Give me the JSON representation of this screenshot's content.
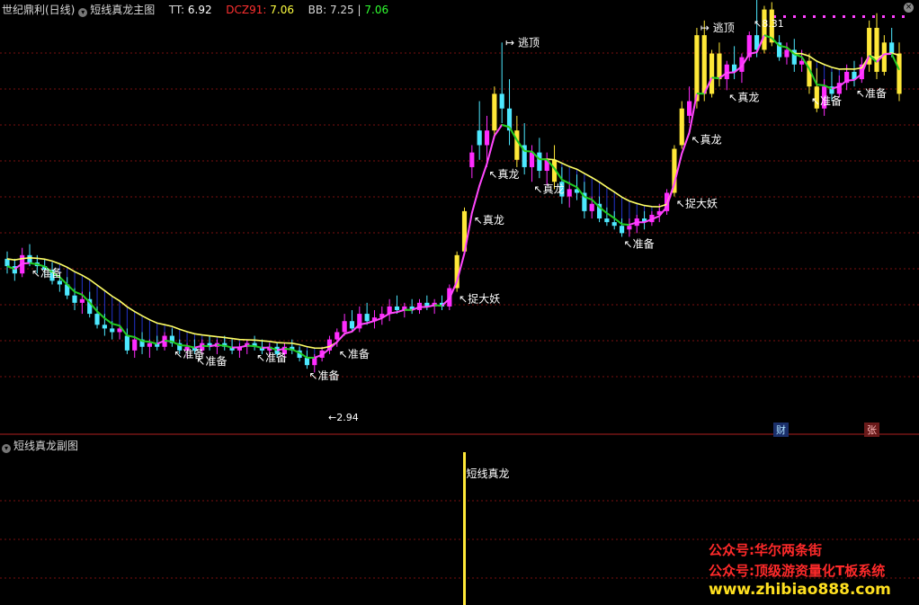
{
  "header": {
    "app_name": "世纪鼎利(日线)",
    "indicator_name": "短线真龙主图",
    "tt_label": "TT:",
    "tt_value": "6.92",
    "dcz_label": "DCZ91:",
    "dcz_value": "7.06",
    "bb_label": "BB:",
    "bb_value": "7.25",
    "bb_value2": "7.06"
  },
  "sub_header": {
    "indicator_name": "短线真龙副图"
  },
  "tags": {
    "cai": "财",
    "zhang": "张"
  },
  "watermark": {
    "line1": "公众号:华尔两条街",
    "line2": "公众号:顶级游资量化T板系统",
    "line3": "www.zhibiao888.com"
  },
  "colors": {
    "up_candle": "#ff2cff",
    "down_candle": "#4de8ff",
    "yellow_candle": "#ffe838",
    "red_candle": "#ff2020",
    "upper_band": "#ffff66",
    "lower_band_rise": "#ff44ff",
    "lower_band_fall": "#22cc22",
    "fill": "#2233cc",
    "grid": "#7a1010"
  },
  "chart_data": {
    "type": "candlestick",
    "price_labels": {
      "low": "2.94",
      "high": "8.31"
    },
    "annotations": [
      {
        "text": "准备",
        "index": 3
      },
      {
        "text": "准备",
        "index": 22
      },
      {
        "text": "准备",
        "index": 25
      },
      {
        "text": "准备",
        "index": 33
      },
      {
        "text": "准备",
        "index": 40
      },
      {
        "text": "准备",
        "index": 44
      },
      {
        "text": "捉大妖",
        "index": 60
      },
      {
        "text": "真龙",
        "index": 62
      },
      {
        "text": "真龙",
        "index": 64
      },
      {
        "text": "逃顶",
        "index": 66
      },
      {
        "text": "真龙",
        "index": 70
      },
      {
        "text": "准备",
        "index": 82
      },
      {
        "text": "捉大妖",
        "index": 89
      },
      {
        "text": "真龙",
        "index": 91
      },
      {
        "text": "逃顶",
        "index": 92
      },
      {
        "text": "真龙",
        "index": 96
      },
      {
        "text": "准备",
        "index": 107
      },
      {
        "text": "准备",
        "index": 113
      }
    ],
    "sub_annotation": "短线真龙",
    "sub_signal_index": 61,
    "candles": [
      {
        "o": 5.05,
        "h": 5.15,
        "l": 4.85,
        "c": 4.95
      },
      {
        "o": 4.95,
        "h": 5.05,
        "l": 4.75,
        "c": 4.85
      },
      {
        "o": 4.85,
        "h": 5.2,
        "l": 4.8,
        "c": 5.1
      },
      {
        "o": 5.1,
        "h": 5.25,
        "l": 4.95,
        "c": 5.0
      },
      {
        "o": 5.0,
        "h": 5.1,
        "l": 4.85,
        "c": 4.95
      },
      {
        "o": 4.95,
        "h": 5.05,
        "l": 4.8,
        "c": 4.9
      },
      {
        "o": 4.9,
        "h": 5.0,
        "l": 4.7,
        "c": 4.75
      },
      {
        "o": 4.75,
        "h": 4.85,
        "l": 4.6,
        "c": 4.7
      },
      {
        "o": 4.7,
        "h": 4.8,
        "l": 4.5,
        "c": 4.55
      },
      {
        "o": 4.55,
        "h": 4.65,
        "l": 4.35,
        "c": 4.45
      },
      {
        "o": 4.45,
        "h": 4.6,
        "l": 4.3,
        "c": 4.5
      },
      {
        "o": 4.5,
        "h": 4.6,
        "l": 4.25,
        "c": 4.3
      },
      {
        "o": 4.3,
        "h": 4.4,
        "l": 4.1,
        "c": 4.15
      },
      {
        "o": 4.15,
        "h": 4.3,
        "l": 4.0,
        "c": 4.1
      },
      {
        "o": 4.1,
        "h": 4.2,
        "l": 3.95,
        "c": 4.05
      },
      {
        "o": 4.05,
        "h": 4.15,
        "l": 3.95,
        "c": 4.1
      },
      {
        "o": 4.0,
        "h": 4.1,
        "l": 3.75,
        "c": 3.8
      },
      {
        "o": 3.8,
        "h": 4.0,
        "l": 3.7,
        "c": 3.95
      },
      {
        "o": 3.95,
        "h": 4.05,
        "l": 3.75,
        "c": 3.85
      },
      {
        "o": 3.85,
        "h": 3.95,
        "l": 3.7,
        "c": 3.9
      },
      {
        "o": 3.9,
        "h": 4.0,
        "l": 3.8,
        "c": 3.85
      },
      {
        "o": 3.85,
        "h": 4.05,
        "l": 3.8,
        "c": 4.0
      },
      {
        "o": 4.0,
        "h": 4.1,
        "l": 3.85,
        "c": 3.9
      },
      {
        "o": 3.9,
        "h": 3.95,
        "l": 3.75,
        "c": 3.8
      },
      {
        "o": 3.8,
        "h": 3.9,
        "l": 3.7,
        "c": 3.85
      },
      {
        "o": 3.85,
        "h": 3.95,
        "l": 3.75,
        "c": 3.8
      },
      {
        "o": 3.8,
        "h": 3.95,
        "l": 3.75,
        "c": 3.9
      },
      {
        "o": 3.9,
        "h": 4.0,
        "l": 3.8,
        "c": 3.85
      },
      {
        "o": 3.85,
        "h": 3.95,
        "l": 3.75,
        "c": 3.9
      },
      {
        "o": 3.9,
        "h": 4.0,
        "l": 3.8,
        "c": 3.85
      },
      {
        "o": 3.85,
        "h": 3.95,
        "l": 3.75,
        "c": 3.8
      },
      {
        "o": 3.8,
        "h": 3.9,
        "l": 3.7,
        "c": 3.85
      },
      {
        "o": 3.85,
        "h": 3.95,
        "l": 3.75,
        "c": 3.9
      },
      {
        "o": 3.9,
        "h": 4.0,
        "l": 3.8,
        "c": 3.85
      },
      {
        "o": 3.85,
        "h": 3.95,
        "l": 3.75,
        "c": 3.8
      },
      {
        "o": 3.8,
        "h": 3.9,
        "l": 3.7,
        "c": 3.85
      },
      {
        "o": 3.85,
        "h": 3.9,
        "l": 3.7,
        "c": 3.75
      },
      {
        "o": 3.75,
        "h": 3.9,
        "l": 3.7,
        "c": 3.85
      },
      {
        "o": 3.85,
        "h": 3.95,
        "l": 3.75,
        "c": 3.8
      },
      {
        "o": 3.8,
        "h": 3.85,
        "l": 3.65,
        "c": 3.7
      },
      {
        "o": 3.7,
        "h": 3.8,
        "l": 3.55,
        "c": 3.6
      },
      {
        "o": 3.6,
        "h": 3.75,
        "l": 3.5,
        "c": 3.7
      },
      {
        "o": 3.7,
        "h": 3.85,
        "l": 3.65,
        "c": 3.8
      },
      {
        "o": 3.8,
        "h": 4.0,
        "l": 3.75,
        "c": 3.95
      },
      {
        "o": 3.95,
        "h": 4.1,
        "l": 3.85,
        "c": 4.05
      },
      {
        "o": 4.05,
        "h": 4.3,
        "l": 4.0,
        "c": 4.2
      },
      {
        "o": 4.2,
        "h": 4.35,
        "l": 4.05,
        "c": 4.1
      },
      {
        "o": 4.1,
        "h": 4.4,
        "l": 4.05,
        "c": 4.3
      },
      {
        "o": 4.3,
        "h": 4.45,
        "l": 4.15,
        "c": 4.2
      },
      {
        "o": 4.2,
        "h": 4.35,
        "l": 4.1,
        "c": 4.25
      },
      {
        "o": 4.25,
        "h": 4.4,
        "l": 4.15,
        "c": 4.3
      },
      {
        "o": 4.3,
        "h": 4.5,
        "l": 4.2,
        "c": 4.4
      },
      {
        "o": 4.4,
        "h": 4.55,
        "l": 4.3,
        "c": 4.35
      },
      {
        "o": 4.35,
        "h": 4.45,
        "l": 4.25,
        "c": 4.4
      },
      {
        "o": 4.4,
        "h": 4.5,
        "l": 4.3,
        "c": 4.35
      },
      {
        "o": 4.35,
        "h": 4.5,
        "l": 4.3,
        "c": 4.45
      },
      {
        "o": 4.45,
        "h": 4.55,
        "l": 4.35,
        "c": 4.4
      },
      {
        "o": 4.4,
        "h": 4.5,
        "l": 4.3,
        "c": 4.45
      },
      {
        "o": 4.45,
        "h": 4.55,
        "l": 4.35,
        "c": 4.4
      },
      {
        "o": 4.4,
        "h": 4.7,
        "l": 4.35,
        "c": 4.65
      },
      {
        "o": 4.65,
        "h": 5.15,
        "l": 4.6,
        "c": 5.1
      },
      {
        "o": 5.15,
        "h": 5.75,
        "l": 5.1,
        "c": 5.7
      },
      {
        "o": 6.3,
        "h": 6.6,
        "l": 6.15,
        "c": 6.5
      },
      {
        "o": 6.8,
        "h": 7.2,
        "l": 6.4,
        "c": 6.6
      },
      {
        "o": 6.6,
        "h": 7.0,
        "l": 6.3,
        "c": 6.8
      },
      {
        "o": 6.8,
        "h": 7.4,
        "l": 6.7,
        "c": 7.3
      },
      {
        "o": 7.3,
        "h": 8.0,
        "l": 6.9,
        "c": 7.1
      },
      {
        "o": 7.1,
        "h": 7.5,
        "l": 6.6,
        "c": 6.8
      },
      {
        "o": 6.8,
        "h": 7.0,
        "l": 6.3,
        "c": 6.4
      },
      {
        "o": 6.6,
        "h": 6.9,
        "l": 6.2,
        "c": 6.3
      },
      {
        "o": 6.3,
        "h": 6.6,
        "l": 6.1,
        "c": 6.5
      },
      {
        "o": 6.5,
        "h": 6.7,
        "l": 6.15,
        "c": 6.25
      },
      {
        "o": 6.25,
        "h": 6.5,
        "l": 6.05,
        "c": 6.4
      },
      {
        "o": 6.4,
        "h": 6.6,
        "l": 6.0,
        "c": 6.1
      },
      {
        "o": 6.1,
        "h": 6.3,
        "l": 5.8,
        "c": 5.9
      },
      {
        "o": 5.9,
        "h": 6.1,
        "l": 5.75,
        "c": 6.0
      },
      {
        "o": 6.0,
        "h": 6.2,
        "l": 5.85,
        "c": 5.95
      },
      {
        "o": 5.95,
        "h": 6.1,
        "l": 5.6,
        "c": 5.7
      },
      {
        "o": 5.7,
        "h": 5.9,
        "l": 5.6,
        "c": 5.8
      },
      {
        "o": 5.8,
        "h": 5.9,
        "l": 5.55,
        "c": 5.6
      },
      {
        "o": 5.6,
        "h": 5.75,
        "l": 5.5,
        "c": 5.55
      },
      {
        "o": 5.55,
        "h": 5.7,
        "l": 5.45,
        "c": 5.5
      },
      {
        "o": 5.5,
        "h": 5.6,
        "l": 5.35,
        "c": 5.4
      },
      {
        "o": 5.45,
        "h": 5.6,
        "l": 5.35,
        "c": 5.5
      },
      {
        "o": 5.5,
        "h": 5.65,
        "l": 5.4,
        "c": 5.6
      },
      {
        "o": 5.6,
        "h": 5.7,
        "l": 5.45,
        "c": 5.55
      },
      {
        "o": 5.55,
        "h": 5.7,
        "l": 5.5,
        "c": 5.65
      },
      {
        "o": 5.65,
        "h": 5.8,
        "l": 5.55,
        "c": 5.7
      },
      {
        "o": 5.7,
        "h": 6.0,
        "l": 5.65,
        "c": 5.95
      },
      {
        "o": 5.95,
        "h": 6.6,
        "l": 5.9,
        "c": 6.55
      },
      {
        "o": 6.6,
        "h": 7.2,
        "l": 6.55,
        "c": 7.1
      },
      {
        "o": 7.0,
        "h": 7.4,
        "l": 6.9,
        "c": 7.2
      },
      {
        "o": 7.2,
        "h": 8.2,
        "l": 7.1,
        "c": 8.1
      },
      {
        "o": 8.1,
        "h": 8.3,
        "l": 7.2,
        "c": 7.3
      },
      {
        "o": 7.3,
        "h": 7.9,
        "l": 7.25,
        "c": 7.85
      },
      {
        "o": 7.85,
        "h": 8.0,
        "l": 7.4,
        "c": 7.5
      },
      {
        "o": 7.5,
        "h": 7.75,
        "l": 7.35,
        "c": 7.7
      },
      {
        "o": 7.7,
        "h": 7.95,
        "l": 7.5,
        "c": 7.6
      },
      {
        "o": 7.6,
        "h": 7.85,
        "l": 7.45,
        "c": 7.8
      },
      {
        "o": 7.8,
        "h": 8.15,
        "l": 7.75,
        "c": 8.1
      },
      {
        "o": 8.1,
        "h": 8.6,
        "l": 7.8,
        "c": 7.9
      },
      {
        "o": 7.9,
        "h": 8.5,
        "l": 7.85,
        "c": 8.45
      },
      {
        "o": 8.45,
        "h": 8.55,
        "l": 7.95,
        "c": 8.0
      },
      {
        "o": 8.0,
        "h": 8.1,
        "l": 7.75,
        "c": 7.8
      },
      {
        "o": 7.8,
        "h": 8.0,
        "l": 7.7,
        "c": 7.9
      },
      {
        "o": 7.9,
        "h": 8.05,
        "l": 7.6,
        "c": 7.7
      },
      {
        "o": 7.7,
        "h": 7.9,
        "l": 7.6,
        "c": 7.75
      },
      {
        "o": 7.75,
        "h": 7.85,
        "l": 7.3,
        "c": 7.4
      },
      {
        "o": 7.4,
        "h": 7.65,
        "l": 7.05,
        "c": 7.1
      },
      {
        "o": 7.1,
        "h": 7.5,
        "l": 7.0,
        "c": 7.4
      },
      {
        "o": 7.4,
        "h": 7.6,
        "l": 7.2,
        "c": 7.3
      },
      {
        "o": 7.3,
        "h": 7.55,
        "l": 7.25,
        "c": 7.45
      },
      {
        "o": 7.45,
        "h": 7.7,
        "l": 7.35,
        "c": 7.6
      },
      {
        "o": 7.6,
        "h": 7.75,
        "l": 7.4,
        "c": 7.5
      },
      {
        "o": 7.5,
        "h": 7.8,
        "l": 7.45,
        "c": 7.7
      },
      {
        "o": 7.7,
        "h": 8.3,
        "l": 7.6,
        "c": 8.2
      },
      {
        "o": 8.2,
        "h": 8.4,
        "l": 7.5,
        "c": 7.6
      },
      {
        "o": 7.6,
        "h": 8.1,
        "l": 7.55,
        "c": 8.0
      },
      {
        "o": 8.0,
        "h": 8.2,
        "l": 7.8,
        "c": 7.85
      },
      {
        "o": 7.85,
        "h": 8.0,
        "l": 7.2,
        "c": 7.3
      }
    ]
  }
}
